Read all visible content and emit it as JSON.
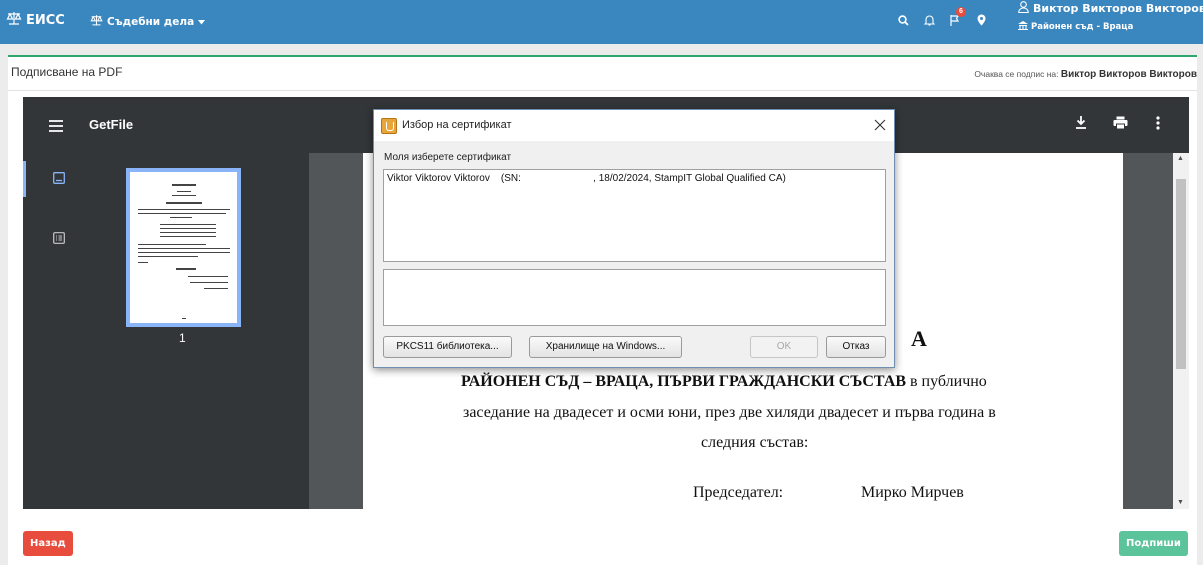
{
  "navbar": {
    "brand": "ЕИСС",
    "menu_label": "Съдебни дела",
    "notifications_count": "6",
    "user_name": "Виктор Викторов Викторов",
    "user_court": "Районен съд - Враца"
  },
  "panel": {
    "title": "Подписване на PDF",
    "awaiting_label": "Очаква се подпис на: ",
    "awaiting_name": "Виктор Викторов Викторов"
  },
  "viewer": {
    "file_title": "GetFile",
    "thumbnail_page_number": "1",
    "page_heading": "А",
    "line1_bold": "РАЙОНЕН СЪД – ВРАЦА, ПЪРВИ ГРАЖДАНСКИ СЪСТАВ",
    "line1_rest": " в публично",
    "line2": "заседание на двадесет и осми юни, през две хиляди двадесет и първа година в",
    "line3": "следния състав:",
    "chair_label": "Председател:",
    "chair_name": "Мирко Мирчев"
  },
  "buttons": {
    "back": "Назад",
    "sign": "Подпиши"
  },
  "dialog": {
    "title": "Избор на сертификат",
    "prompt": "Моля изберете сертификат",
    "certificates": [
      "Viktor Viktorov Viktorov    (SN:                          , 18/02/2024, StampIT Global Qualified CA)"
    ],
    "pkcs_button": "PKCS11 библиотека...",
    "windows_store_button": "Хранилище на Windows...",
    "ok_button": "OK",
    "cancel_button": "Отказ"
  },
  "colors": {
    "navbar": "#3a87c0",
    "accent_green": "#2fa66b",
    "danger": "#e74c3c",
    "success": "#5cc49a",
    "viewer_dark": "#323639"
  }
}
